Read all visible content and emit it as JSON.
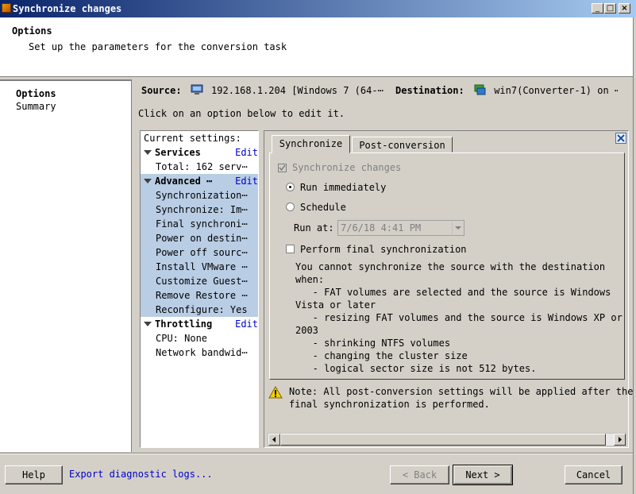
{
  "window": {
    "title": "Synchronize changes"
  },
  "header": {
    "title": "Options",
    "subtitle": "Set up the parameters for the conversion task"
  },
  "nav": {
    "items": [
      "Options",
      "Summary"
    ]
  },
  "source_dest": {
    "source_label": "Source:",
    "source_value": "192.168.1.204 [Windows 7 (64-⋯",
    "dest_label": "Destination:",
    "dest_value": "win7(Converter-1) on ⋯"
  },
  "hint": "Click on an option below to edit it.",
  "settings": {
    "header": "Current settings:",
    "edit_label": "Edit",
    "groups": {
      "services": {
        "name": "Services",
        "items": [
          "Total: 162 serv⋯"
        ]
      },
      "advanced": {
        "name": "Advanced ⋯",
        "items": [
          "Synchronization⋯",
          "Synchronize: Im⋯",
          "Final synchroni⋯",
          "Power on destin⋯",
          "Power off sourc⋯",
          "Install VMware ⋯",
          "Customize Guest⋯",
          "Remove Restore ⋯",
          "Reconfigure: Yes"
        ]
      },
      "throttling": {
        "name": "Throttling",
        "items": [
          "CPU: None",
          "Network bandwid⋯"
        ]
      }
    }
  },
  "tabs": [
    "Synchronize",
    "Post-conversion"
  ],
  "sync": {
    "sync_changes_label": "Synchronize changes",
    "run_immediately": "Run immediately",
    "schedule": "Schedule",
    "run_at_label": "Run at:",
    "run_at_value": "7/6/18 4:41 PM",
    "final_sync_label": "Perform final synchronization",
    "warning": "You cannot synchronize the source with the destination\nwhen:\n   - FAT volumes are selected and the source is Windows\nVista or later\n   - resizing FAT volumes and the source is Windows XP or\n2003\n   - shrinking NTFS volumes\n   - changing the cluster size\n   - logical sector size is not 512 bytes."
  },
  "note": "Note: All post-conversion settings will be applied after the\nfinal synchronization is performed.",
  "buttons": {
    "help": "Help",
    "export": "Export diagnostic logs...",
    "back": "< Back",
    "next": "Next >",
    "cancel": "Cancel"
  },
  "icons": {
    "warning": "warning-icon",
    "monitor": "monitor-icon",
    "vm": "virtual-machine-icon"
  }
}
